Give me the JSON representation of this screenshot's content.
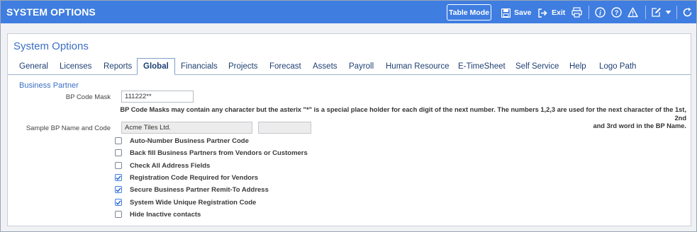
{
  "app": {
    "title": "SYSTEM OPTIONS"
  },
  "toolbar": {
    "table_mode": "Table Mode",
    "save": "Save",
    "exit": "Exit"
  },
  "panel": {
    "title": "System Options"
  },
  "tabs": [
    {
      "label": "General"
    },
    {
      "label": "Licenses"
    },
    {
      "label": "Reports"
    },
    {
      "label": "Global",
      "active": true
    },
    {
      "label": "Financials"
    },
    {
      "label": "Projects"
    },
    {
      "label": "Forecast"
    },
    {
      "label": "Assets"
    },
    {
      "label": "Payroll"
    },
    {
      "label": "Human Resource"
    },
    {
      "label": "E-TimeSheet"
    },
    {
      "label": "Self Service"
    },
    {
      "label": "Help"
    },
    {
      "label": "Logo Path"
    }
  ],
  "business_partner": {
    "section_title": "Business Partner",
    "code_mask_label": "BP Code Mask",
    "code_mask_value": "111222**",
    "hint_line1": "BP Code Masks may contain any character but the asterix \"*\" is a special place holder for each digit of the next number. The numbers 1,2,3 are used for the next character of the 1st, 2nd",
    "hint_line2": "and 3rd word in the BP Name.",
    "sample_label": "Sample BP Name and Code",
    "sample_name": "Acme Tiles Ltd.",
    "sample_code": "",
    "options": [
      {
        "label": "Auto-Number Business Partner Code",
        "checked": false
      },
      {
        "label": "Back fill Business Partners from Vendors or Customers",
        "checked": false
      },
      {
        "label": "Check All Address Fields",
        "checked": false
      },
      {
        "label": "Registration Code Required for Vendors",
        "checked": true
      },
      {
        "label": "Secure Business Partner Remit-To Address",
        "checked": true
      },
      {
        "label": "System Wide Unique Registration Code",
        "checked": true
      },
      {
        "label": "Hide Inactive contacts",
        "checked": false
      }
    ]
  },
  "colors": {
    "header_bg": "#3f7de0",
    "accent": "#3a6fc4",
    "tab_text": "#1f3f73"
  },
  "icons": [
    "save-icon",
    "exit-icon",
    "print-icon",
    "info-icon",
    "help-icon",
    "warning-icon",
    "edit-icon",
    "chevron-down-icon",
    "refresh-icon"
  ]
}
